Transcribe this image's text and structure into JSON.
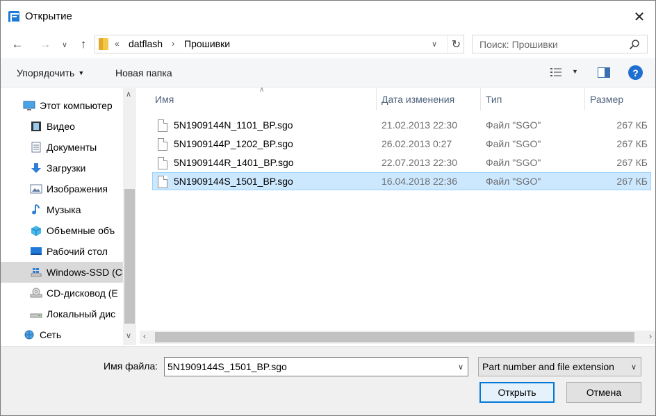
{
  "window": {
    "title": "Открытие"
  },
  "address": {
    "overflow": "«",
    "breadcrumbs": [
      "datflash",
      "Прошивки"
    ]
  },
  "search": {
    "placeholder": "Поиск: Прошивки"
  },
  "toolbar": {
    "organize_label": "Упорядочить",
    "new_folder_label": "Новая папка",
    "help_label": "?"
  },
  "nav": {
    "items": [
      {
        "label": "Этот компьютер",
        "icon": "computer-icon",
        "indent": 1
      },
      {
        "label": "Видео",
        "icon": "video-icon",
        "indent": 2
      },
      {
        "label": "Документы",
        "icon": "documents-icon",
        "indent": 2
      },
      {
        "label": "Загрузки",
        "icon": "downloads-icon",
        "indent": 2
      },
      {
        "label": "Изображения",
        "icon": "pictures-icon",
        "indent": 2
      },
      {
        "label": "Музыка",
        "icon": "music-icon",
        "indent": 2
      },
      {
        "label": "Объемные объ",
        "icon": "3d-objects-icon",
        "indent": 2
      },
      {
        "label": "Рабочий стол",
        "icon": "desktop-icon",
        "indent": 2
      },
      {
        "label": "Windows-SSD (C",
        "icon": "drive-windows-icon",
        "indent": 2,
        "selected": true
      },
      {
        "label": "CD-дисковод (E",
        "icon": "cd-drive-icon",
        "indent": 2
      },
      {
        "label": "Локальный дис",
        "icon": "local-disk-icon",
        "indent": 2
      },
      {
        "label": "Сеть",
        "icon": "network-icon",
        "indent": 1
      }
    ]
  },
  "columns": {
    "name": "Имя",
    "date": "Дата изменения",
    "type": "Тип",
    "size": "Размер"
  },
  "files": [
    {
      "name": "5N1909144N_1101_BP.sgo",
      "date": "21.02.2013 22:30",
      "type": "Файл \"SGO\"",
      "size": "267 КБ"
    },
    {
      "name": "5N1909144P_1202_BP.sgo",
      "date": "26.02.2013 0:27",
      "type": "Файл \"SGO\"",
      "size": "267 КБ"
    },
    {
      "name": "5N1909144R_1401_BP.sgo",
      "date": "22.07.2013 22:30",
      "type": "Файл \"SGO\"",
      "size": "267 КБ"
    },
    {
      "name": "5N1909144S_1501_BP.sgo",
      "date": "16.04.2018 22:36",
      "type": "Файл \"SGO\"",
      "size": "267 КБ",
      "selected": true
    }
  ],
  "bottom": {
    "filename_label": "Имя файла:",
    "filename_value": "5N1909144S_1501_BP.sgo",
    "filetype_value": "Part number and file extension",
    "open_label": "Открыть",
    "cancel_label": "Отмена"
  }
}
